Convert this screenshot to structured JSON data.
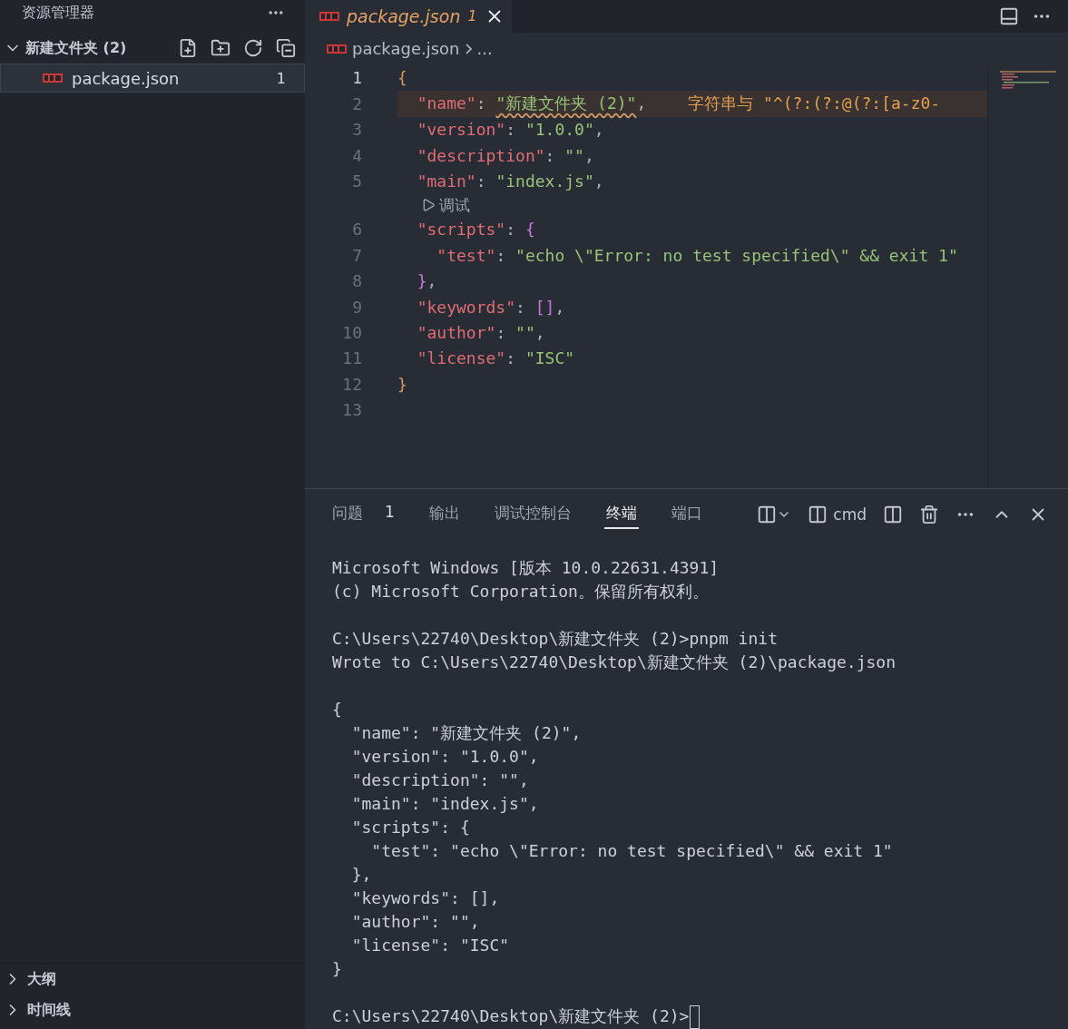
{
  "sidebar": {
    "title": "资源管理器",
    "folder": {
      "label": "新建文件夹 (2)",
      "expanded": true,
      "files": [
        {
          "name": "package.json",
          "badge": "1",
          "selected": true
        }
      ]
    },
    "sections": [
      {
        "label": "大纲",
        "expanded": false
      },
      {
        "label": "时间线",
        "expanded": false
      }
    ]
  },
  "editor": {
    "tabs": [
      {
        "label": "package.json",
        "badge": "1",
        "selected": true
      }
    ],
    "breadcrumb": {
      "file": "package.json",
      "rest": "..."
    },
    "lines": [
      {
        "kind": "code",
        "number": "1",
        "active": true,
        "tokens": [
          {
            "kind": "brace",
            "text": "{"
          }
        ]
      },
      {
        "kind": "code",
        "number": "2",
        "active": false,
        "diagnostic": "字符串与 \"^(?:(?:@(?:[a-z0-",
        "tokens": [
          {
            "kind": "key",
            "text": "  \"name\""
          },
          {
            "kind": "punct",
            "text": ": "
          },
          {
            "kind": "string",
            "text": "\"新建文件夹 (2)\"",
            "squiggle": true
          },
          {
            "kind": "punct",
            "text": ","
          }
        ]
      },
      {
        "kind": "code",
        "number": "3",
        "active": false,
        "tokens": [
          {
            "kind": "key",
            "text": "  \"version\""
          },
          {
            "kind": "punct",
            "text": ": "
          },
          {
            "kind": "string",
            "text": "\"1.0.0\""
          },
          {
            "kind": "punct",
            "text": ","
          }
        ]
      },
      {
        "kind": "code",
        "number": "4",
        "active": false,
        "tokens": [
          {
            "kind": "key",
            "text": "  \"description\""
          },
          {
            "kind": "punct",
            "text": ": "
          },
          {
            "kind": "string",
            "text": "\"\""
          },
          {
            "kind": "punct",
            "text": ","
          }
        ]
      },
      {
        "kind": "code",
        "number": "5",
        "active": false,
        "tokens": [
          {
            "kind": "key",
            "text": "  \"main\""
          },
          {
            "kind": "punct",
            "text": ": "
          },
          {
            "kind": "string",
            "text": "\"index.js\""
          },
          {
            "kind": "punct",
            "text": ","
          }
        ]
      },
      {
        "kind": "codelens",
        "label": "调试"
      },
      {
        "kind": "code",
        "number": "6",
        "active": false,
        "tokens": [
          {
            "kind": "key",
            "text": "  \"scripts\""
          },
          {
            "kind": "punct",
            "text": ": "
          },
          {
            "kind": "bracket",
            "text": "{"
          }
        ]
      },
      {
        "kind": "code",
        "number": "7",
        "active": false,
        "tokens": [
          {
            "kind": "key",
            "text": "    \"test\""
          },
          {
            "kind": "punct",
            "text": ": "
          },
          {
            "kind": "string",
            "text": "\"echo \\\"Error: no test specified\\\" && exit 1\""
          }
        ]
      },
      {
        "kind": "code",
        "number": "8",
        "active": false,
        "tokens": [
          {
            "kind": "bracket",
            "text": "  }"
          },
          {
            "kind": "punct",
            "text": ","
          }
        ]
      },
      {
        "kind": "code",
        "number": "9",
        "active": false,
        "tokens": [
          {
            "kind": "key",
            "text": "  \"keywords\""
          },
          {
            "kind": "punct",
            "text": ": "
          },
          {
            "kind": "bracket",
            "text": "[]"
          },
          {
            "kind": "punct",
            "text": ","
          }
        ]
      },
      {
        "kind": "code",
        "number": "10",
        "active": false,
        "tokens": [
          {
            "kind": "key",
            "text": "  \"author\""
          },
          {
            "kind": "punct",
            "text": ": "
          },
          {
            "kind": "string",
            "text": "\"\""
          },
          {
            "kind": "punct",
            "text": ","
          }
        ]
      },
      {
        "kind": "code",
        "number": "11",
        "active": false,
        "tokens": [
          {
            "kind": "key",
            "text": "  \"license\""
          },
          {
            "kind": "punct",
            "text": ": "
          },
          {
            "kind": "string",
            "text": "\"ISC\""
          }
        ]
      },
      {
        "kind": "code",
        "number": "12",
        "active": false,
        "tokens": [
          {
            "kind": "brace",
            "text": "}"
          }
        ]
      },
      {
        "kind": "code",
        "number": "13",
        "active": false
      }
    ]
  },
  "panel": {
    "tabs": [
      {
        "label": "问题",
        "count": "1",
        "selected": false
      },
      {
        "label": "输出",
        "selected": false
      },
      {
        "label": "调试控制台",
        "selected": false
      },
      {
        "label": "终端",
        "selected": true
      },
      {
        "label": "端口",
        "selected": false
      }
    ],
    "terminal_name": "cmd",
    "terminal": [
      [
        "Microsoft Windows [版本 10.0.22631.4391]",
        "(c) Microsoft Corporation。保留所有权利。"
      ],
      [
        "C:\\Users\\22740\\Desktop\\新建文件夹 (2)>pnpm init",
        "Wrote to C:\\Users\\22740\\Desktop\\新建文件夹 (2)\\package.json"
      ],
      [
        "{",
        "  \"name\": \"新建文件夹 (2)\",",
        "  \"version\": \"1.0.0\",",
        "  \"description\": \"\",",
        "  \"main\": \"index.js\",",
        "  \"scripts\": {",
        "    \"test\": \"echo \\\"Error: no test specified\\\" && exit 1\"",
        "  },",
        "  \"keywords\": [],",
        "  \"author\": \"\",",
        "  \"license\": \"ISC\"",
        "}"
      ]
    ],
    "prompt": "C:\\Users\\22740\\Desktop\\新建文件夹 (2)>"
  }
}
